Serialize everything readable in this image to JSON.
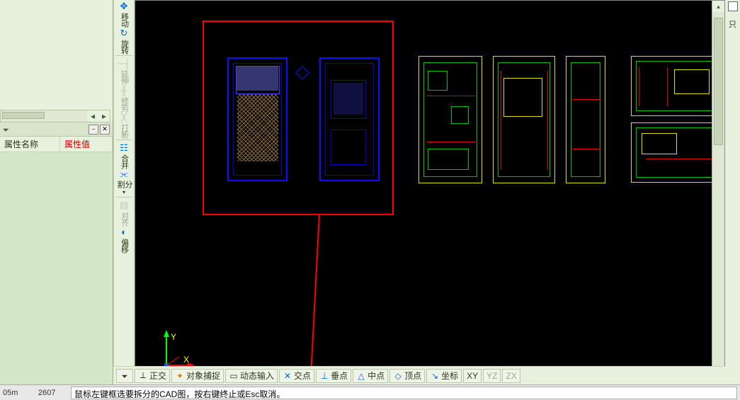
{
  "leftPanel": {
    "nameHeader": "属性名称",
    "valueHeader": "属性值"
  },
  "tools": [
    {
      "id": "move",
      "label": "移动",
      "icon": "✥",
      "color": "#0066cc",
      "enabled": true
    },
    {
      "id": "rotate",
      "label": "旋转",
      "icon": "↻",
      "color": "#0066cc",
      "enabled": true
    },
    {
      "id": "extend",
      "label": "延伸",
      "icon": "─┤",
      "color": "#888",
      "enabled": false
    },
    {
      "id": "trim",
      "label": "修剪",
      "icon": "╫",
      "color": "#888",
      "enabled": false
    },
    {
      "id": "break",
      "label": "打断",
      "icon": "╳",
      "color": "#888",
      "enabled": false
    },
    {
      "id": "merge",
      "label": "合并",
      "icon": "☷",
      "color": "#0066cc",
      "enabled": true
    },
    {
      "id": "split",
      "label": "分割",
      "icon": "⫘",
      "color": "#0066cc",
      "enabled": true
    },
    {
      "id": "align",
      "label": "对齐",
      "icon": "▤",
      "color": "#888",
      "enabled": false
    },
    {
      "id": "offset",
      "label": "偏移",
      "icon": "◐",
      "color": "#0066cc",
      "enabled": true
    }
  ],
  "snapBar": {
    "ortho": "正交",
    "osnap": "对象捕捉",
    "dyn": "动态输入",
    "int": "交点",
    "perp": "垂点",
    "mid": "中点",
    "apex": "顶点",
    "coord": "坐标",
    "xy": "XY",
    "yz": "YZ",
    "zx": "ZX"
  },
  "ucs": {
    "x": "X",
    "y": "Y"
  },
  "cmd": {
    "coord1": "05m",
    "coord2": "2607",
    "prompt": "鼠标左键框选要拆分的CAD图，按右键终止或Esc取消。"
  },
  "rightStrip": {
    "label": "只"
  }
}
